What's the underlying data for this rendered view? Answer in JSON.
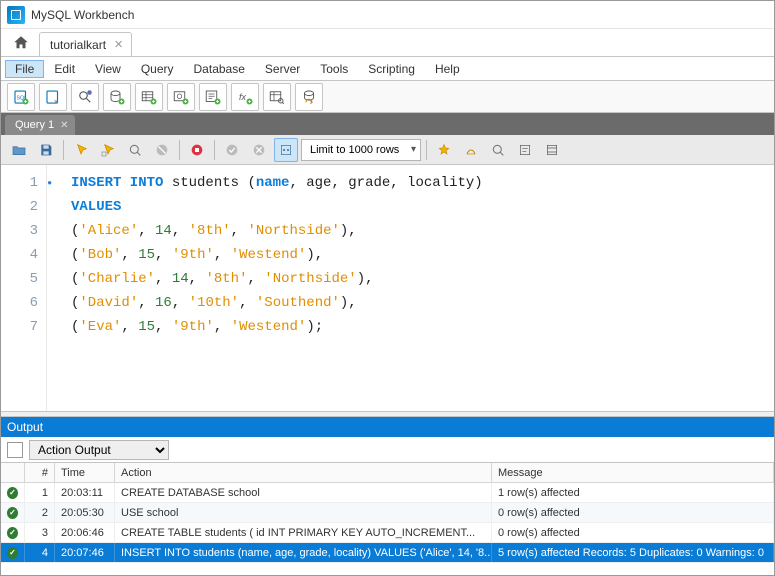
{
  "title": "MySQL Workbench",
  "document_tab": "tutorialkart",
  "menus": [
    "File",
    "Edit",
    "View",
    "Query",
    "Database",
    "Server",
    "Tools",
    "Scripting",
    "Help"
  ],
  "active_menu": 0,
  "query_tab": "Query 1",
  "limit_label": "Limit to 1000 rows",
  "code_lines": [
    {
      "n": 1,
      "dot": true,
      "html": "<span class='kw'>INSERT INTO</span> <span class='plain'>students (</span><span class='fn'>name</span><span class='plain'>, age, grade, locality)</span>"
    },
    {
      "n": 2,
      "dot": false,
      "html": "<span class='kw'>VALUES</span>"
    },
    {
      "n": 3,
      "dot": false,
      "html": "<span class='plain'>(</span><span class='str'>'Alice'</span><span class='plain'>, </span><span class='num'>14</span><span class='plain'>, </span><span class='str'>'8th'</span><span class='plain'>, </span><span class='str'>'Northside'</span><span class='plain'>),</span>"
    },
    {
      "n": 4,
      "dot": false,
      "html": "<span class='plain'>(</span><span class='str'>'Bob'</span><span class='plain'>, </span><span class='num'>15</span><span class='plain'>, </span><span class='str'>'9th'</span><span class='plain'>, </span><span class='str'>'Westend'</span><span class='plain'>),</span>"
    },
    {
      "n": 5,
      "dot": false,
      "html": "<span class='plain'>(</span><span class='str'>'Charlie'</span><span class='plain'>, </span><span class='num'>14</span><span class='plain'>, </span><span class='str'>'8th'</span><span class='plain'>, </span><span class='str'>'Northside'</span><span class='plain'>),</span>"
    },
    {
      "n": 6,
      "dot": false,
      "html": "<span class='plain'>(</span><span class='str'>'David'</span><span class='plain'>, </span><span class='num'>16</span><span class='plain'>, </span><span class='str'>'10th'</span><span class='plain'>, </span><span class='str'>'Southend'</span><span class='plain'>),</span>"
    },
    {
      "n": 7,
      "dot": false,
      "html": "<span class='plain'>(</span><span class='str'>'Eva'</span><span class='plain'>, </span><span class='num'>15</span><span class='plain'>, </span><span class='str'>'9th'</span><span class='plain'>, </span><span class='str'>'Westend'</span><span class='plain'>);</span>"
    }
  ],
  "output": {
    "header": "Output",
    "mode": "Action Output",
    "cols": {
      "num": "#",
      "time": "Time",
      "action": "Action",
      "message": "Message"
    },
    "rows": [
      {
        "n": 1,
        "time": "20:03:11",
        "action": "CREATE DATABASE school",
        "msg": "1 row(s) affected",
        "sel": false,
        "alt": false
      },
      {
        "n": 2,
        "time": "20:05:30",
        "action": "USE school",
        "msg": "0 row(s) affected",
        "sel": false,
        "alt": true
      },
      {
        "n": 3,
        "time": "20:06:46",
        "action": "CREATE TABLE students (     id INT PRIMARY KEY AUTO_INCREMENT...",
        "msg": "0 row(s) affected",
        "sel": false,
        "alt": false
      },
      {
        "n": 4,
        "time": "20:07:46",
        "action": "INSERT INTO students (name, age, grade, locality) VALUES ('Alice', 14, '8...",
        "msg": "5 row(s) affected Records: 5  Duplicates: 0  Warnings: 0",
        "sel": true,
        "alt": false
      }
    ]
  }
}
